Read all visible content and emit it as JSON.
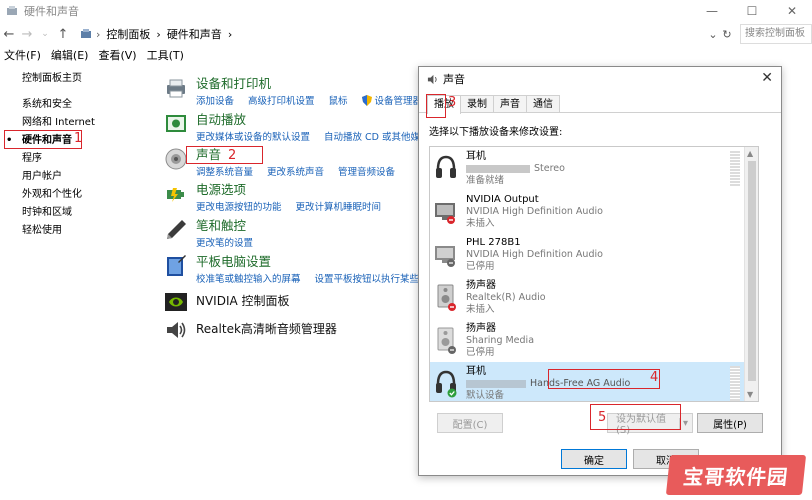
{
  "window": {
    "title": "硬件和声音",
    "controls": [
      "—",
      "☐",
      "✕"
    ]
  },
  "address": {
    "crumbs": [
      "控制面板",
      "›",
      "硬件和声音",
      "›"
    ],
    "dropdown": "⌄",
    "refresh": "↻",
    "search_placeholder": "搜索控制面板"
  },
  "menu": [
    "文件(F)",
    "编辑(E)",
    "查看(V)",
    "工具(T)"
  ],
  "sidebar": {
    "home": "控制面板主页",
    "items": [
      "系统和安全",
      "网络和 Internet",
      "硬件和声音",
      "程序",
      "用户帐户",
      "外观和个性化",
      "时钟和区域",
      "轻松使用"
    ],
    "active_index": 2
  },
  "categories": [
    {
      "title": "设备和打印机",
      "links": [
        "添加设备",
        "高级打印机设置",
        "鼠标",
        "设备管理器"
      ]
    },
    {
      "title": "自动播放",
      "links": [
        "更改媒体或设备的默认设置",
        "自动播放 CD 或其他媒体"
      ]
    },
    {
      "title": "声音",
      "links": [
        "调整系统音量",
        "更改系统声音",
        "管理音频设备"
      ]
    },
    {
      "title": "电源选项",
      "links": [
        "更改电源按钮的功能",
        "更改计算机睡眠时间"
      ]
    },
    {
      "title": "笔和触控",
      "links": [
        "更改笔的设置"
      ]
    },
    {
      "title": "平板电脑设置",
      "links": [
        "校准笔或触控输入的屏幕",
        "设置平板按钮以执行某些任务"
      ]
    },
    {
      "title": "NVIDIA 控制面板",
      "links": []
    },
    {
      "title": "Realtek高清晰音频管理器",
      "links": []
    }
  ],
  "dialog": {
    "title": "声音",
    "close": "✕",
    "tabs": [
      "播放",
      "录制",
      "声音",
      "通信"
    ],
    "active_tab": 0,
    "instruction": "选择以下播放设备来修改设置:",
    "devices": [
      {
        "name": "耳机",
        "sub": "Stereo",
        "status": "准备就绪",
        "icon": "headphones-icon",
        "selected": false
      },
      {
        "name": "NVIDIA Output",
        "sub": "NVIDIA High Definition Audio",
        "status": "未插入",
        "icon": "monitor-icon",
        "selected": false
      },
      {
        "name": "PHL 278B1",
        "sub": "NVIDIA High Definition Audio",
        "status": "已停用",
        "icon": "monitor-icon",
        "selected": false
      },
      {
        "name": "扬声器",
        "sub": "Realtek(R) Audio",
        "status": "未插入",
        "icon": "speaker-icon",
        "selected": false
      },
      {
        "name": "扬声器",
        "sub": "Sharing Media",
        "status": "已停用",
        "icon": "speaker-icon",
        "selected": false
      },
      {
        "name": "耳机",
        "sub": "Hands-Free AG Audio",
        "status": "默认设备",
        "icon": "headphones-icon",
        "selected": true
      }
    ],
    "buttons": {
      "configure": "配置(C)",
      "set_default": "设为默认值(S)",
      "set_default_arrow": "▾",
      "properties": "属性(P)",
      "ok": "确定",
      "cancel": "取消"
    }
  },
  "annotations": [
    "1",
    "2",
    "3",
    "4",
    "5"
  ],
  "watermark": "宝哥软件园",
  "colors": {
    "link": "#1a62b8",
    "category": "#1e6b2a",
    "highlight": "#d9262c",
    "selection": "#cde8fb"
  }
}
